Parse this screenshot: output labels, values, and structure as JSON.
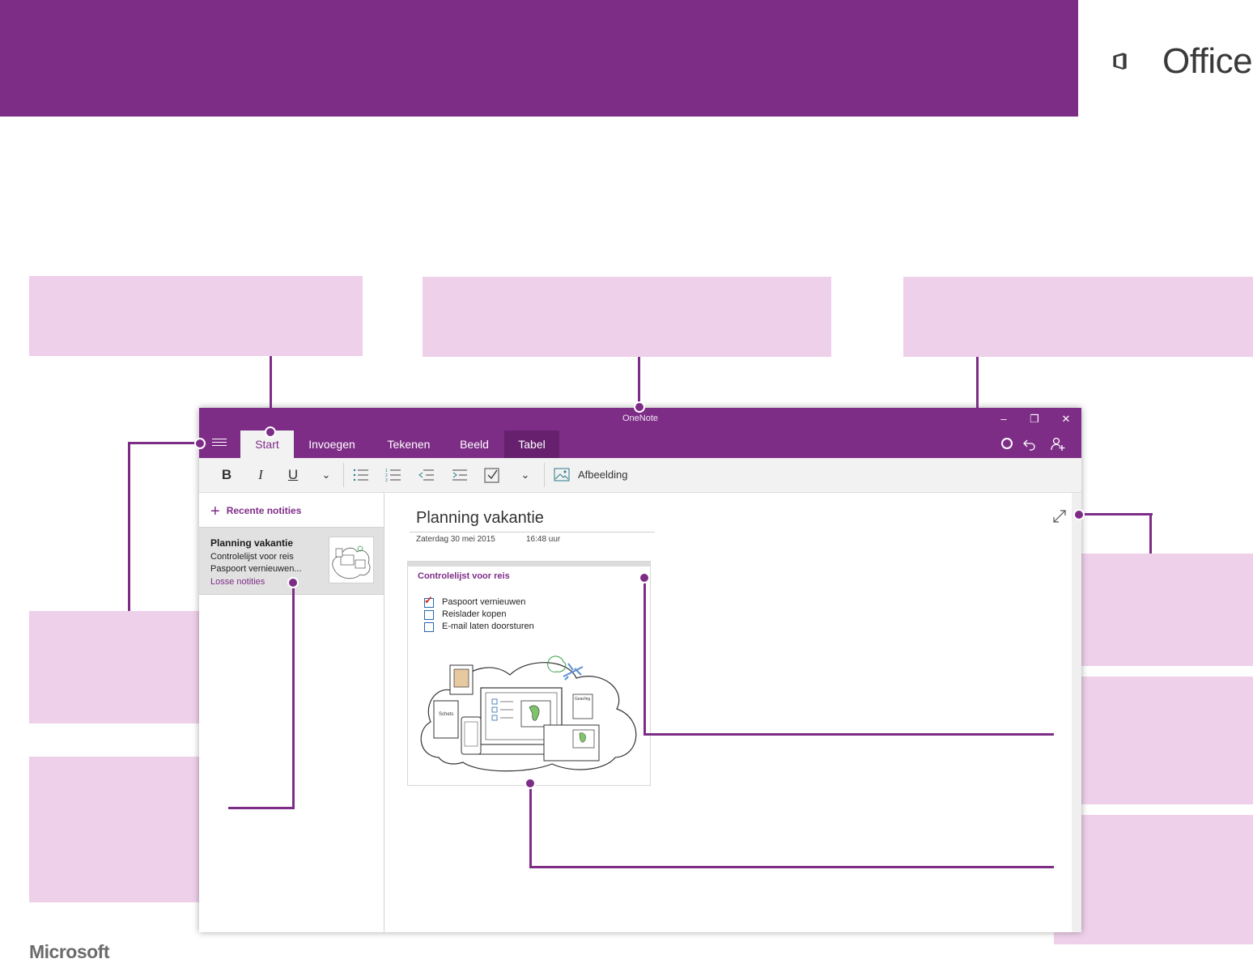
{
  "brand": {
    "office_label": "Office",
    "microsoft_label": "Microsoft"
  },
  "app": {
    "window_title": "OneNote",
    "controls": {
      "minimize": "–",
      "restore": "❐",
      "close": "✕"
    },
    "tabs": [
      {
        "label": "Start",
        "active": true
      },
      {
        "label": "Invoegen",
        "active": false
      },
      {
        "label": "Tekenen",
        "active": false
      },
      {
        "label": "Beeld",
        "active": false
      },
      {
        "label": "Tabel",
        "active": false
      }
    ],
    "ribbon": {
      "bold": "B",
      "italic": "I",
      "underline": "U",
      "more": "⌄",
      "more2": "⌄",
      "picture_label": "Afbeelding"
    },
    "sidebar": {
      "recent_label": "Recente notities",
      "page": {
        "title": "Planning vakantie",
        "line1": "Controlelijst voor reis",
        "line2": "Paspoort vernieuwen...",
        "section": "Losse notities"
      }
    },
    "page": {
      "title": "Planning vakantie",
      "date": "Zaterdag 30 mei 2015",
      "time": "16:48 uur",
      "note": {
        "title": "Controlelijst voor reis",
        "items": [
          {
            "label": "Paspoort vernieuwen",
            "checked": true
          },
          {
            "label": "Reislader kopen",
            "checked": false
          },
          {
            "label": "E-mail laten doorsturen",
            "checked": false
          }
        ],
        "sketch_label": "Schets",
        "sketch_label2": "Gear/ing"
      }
    }
  },
  "colors": {
    "brand_purple": "#7e2d87",
    "callout_pink": "#efd0eb",
    "check_red": "#d0281a"
  }
}
